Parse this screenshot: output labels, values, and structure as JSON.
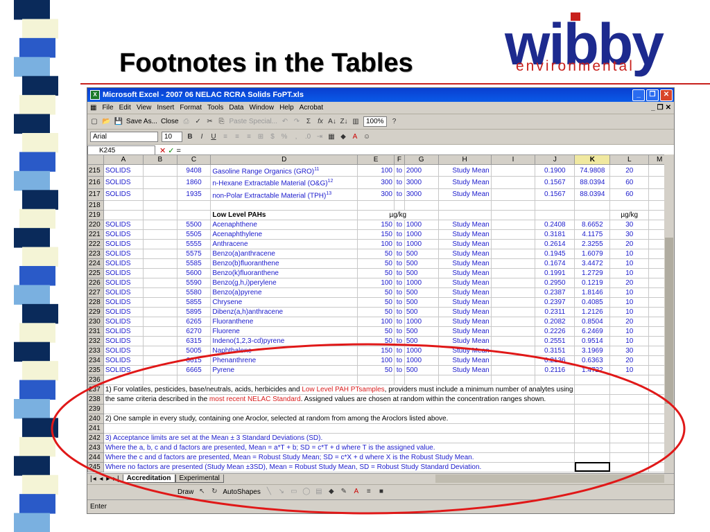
{
  "slide": {
    "title": "Footnotes in the Tables",
    "logo_word": "wibby",
    "logo_sub": "environmental",
    "stripe_colors": [
      "#0a2a5a",
      "#f4f4d6",
      "#2a5ac8",
      "#7ab0e0",
      "#0a2a5a",
      "#f4f4d6"
    ]
  },
  "excel": {
    "title": "Microsoft Excel - 2007 06 NELAC RCRA Solids FoPT.xls",
    "menu": [
      "File",
      "Edit",
      "View",
      "Insert",
      "Format",
      "Tools",
      "Data",
      "Window",
      "Help",
      "Acrobat"
    ],
    "toolbar1": {
      "save_as": "Save As...",
      "close": "Close",
      "paste_special": "Paste Special...",
      "zoom": "100%"
    },
    "toolbar2": {
      "font": "Arial",
      "size": "10"
    },
    "name_box": "K245",
    "columns": [
      "A",
      "B",
      "C",
      "D",
      "E",
      "F",
      "G",
      "H",
      "I",
      "J",
      "K",
      "L",
      "M"
    ],
    "rows": [
      {
        "n": "215",
        "a": "SOLIDS",
        "c": "9408",
        "d": "Gasoline Range Organics (GRO)",
        "sup": "11",
        "e": "100",
        "f": "to",
        "g": "2000",
        "h": "Study Mean",
        "j": "0.1900",
        "k": "74.9808",
        "l": "20"
      },
      {
        "n": "216",
        "a": "SOLIDS",
        "c": "1860",
        "d": "n-Hexane Extractable Material (O&G)",
        "sup": "12",
        "e": "300",
        "f": "to",
        "g": "3000",
        "h": "Study Mean",
        "j": "0.1567",
        "k": "88.0394",
        "l": "60"
      },
      {
        "n": "217",
        "a": "SOLIDS",
        "c": "1935",
        "d": "non-Polar Extractable Material (TPH)",
        "sup": "13",
        "e": "300",
        "f": "to",
        "g": "3000",
        "h": "Study Mean",
        "j": "0.1567",
        "k": "88.0394",
        "l": "60"
      },
      {
        "n": "218"
      },
      {
        "n": "219",
        "d": "Low Level PAHs",
        "ef": "µg/kg",
        "l": "µg/kg",
        "hdr": true
      },
      {
        "n": "220",
        "a": "SOLIDS",
        "c": "5500",
        "d": "Acenaphthene",
        "e": "150",
        "f": "to",
        "g": "1000",
        "h": "Study Mean",
        "j": "0.2408",
        "k": "8.6652",
        "l": "30"
      },
      {
        "n": "221",
        "a": "SOLIDS",
        "c": "5505",
        "d": "Acenaphthylene",
        "e": "150",
        "f": "to",
        "g": "1000",
        "h": "Study Mean",
        "j": "0.3181",
        "k": "4.1175",
        "l": "30"
      },
      {
        "n": "222",
        "a": "SOLIDS",
        "c": "5555",
        "d": "Anthracene",
        "e": "100",
        "f": "to",
        "g": "1000",
        "h": "Study Mean",
        "j": "0.2614",
        "k": "2.3255",
        "l": "20"
      },
      {
        "n": "223",
        "a": "SOLIDS",
        "c": "5575",
        "d": "Benzo(a)anthracene",
        "e": "50",
        "f": "to",
        "g": "500",
        "h": "Study Mean",
        "j": "0.1945",
        "k": "1.6079",
        "l": "10"
      },
      {
        "n": "224",
        "a": "SOLIDS",
        "c": "5585",
        "d": "Benzo(b)fluoranthene",
        "e": "50",
        "f": "to",
        "g": "500",
        "h": "Study Mean",
        "j": "0.1674",
        "k": "3.4472",
        "l": "10"
      },
      {
        "n": "225",
        "a": "SOLIDS",
        "c": "5600",
        "d": "Benzo(k)fluoranthene",
        "e": "50",
        "f": "to",
        "g": "500",
        "h": "Study Mean",
        "j": "0.1991",
        "k": "1.2729",
        "l": "10"
      },
      {
        "n": "226",
        "a": "SOLIDS",
        "c": "5590",
        "d": "Benzo(g,h,i)perylene",
        "e": "100",
        "f": "to",
        "g": "1000",
        "h": "Study Mean",
        "j": "0.2950",
        "k": "0.1219",
        "l": "20"
      },
      {
        "n": "227",
        "a": "SOLIDS",
        "c": "5580",
        "d": "Benzo(a)pyrene",
        "e": "50",
        "f": "to",
        "g": "500",
        "h": "Study Mean",
        "j": "0.2387",
        "k": "1.8146",
        "l": "10"
      },
      {
        "n": "228",
        "a": "SOLIDS",
        "c": "5855",
        "d": "Chrysene",
        "e": "50",
        "f": "to",
        "g": "500",
        "h": "Study Mean",
        "j": "0.2397",
        "k": "0.4085",
        "l": "10"
      },
      {
        "n": "229",
        "a": "SOLIDS",
        "c": "5895",
        "d": "Dibenz(a,h)anthracene",
        "e": "50",
        "f": "to",
        "g": "500",
        "h": "Study Mean",
        "j": "0.2311",
        "k": "1.2126",
        "l": "10"
      },
      {
        "n": "230",
        "a": "SOLIDS",
        "c": "6265",
        "d": "Fluoranthene",
        "e": "100",
        "f": "to",
        "g": "1000",
        "h": "Study Mean",
        "j": "0.2082",
        "k": "0.8504",
        "l": "20"
      },
      {
        "n": "231",
        "a": "SOLIDS",
        "c": "6270",
        "d": "Fluorene",
        "e": "50",
        "f": "to",
        "g": "500",
        "h": "Study Mean",
        "j": "0.2226",
        "k": "6.2469",
        "l": "10"
      },
      {
        "n": "232",
        "a": "SOLIDS",
        "c": "6315",
        "d": "Indeno(1,2,3-cd)pyrene",
        "e": "50",
        "f": "to",
        "g": "500",
        "h": "Study Mean",
        "j": "0.2551",
        "k": "0.9514",
        "l": "10"
      },
      {
        "n": "233",
        "a": "SOLIDS",
        "c": "5005",
        "d": "Naphthalene",
        "e": "150",
        "f": "to",
        "g": "1000",
        "h": "Study Mean",
        "j": "0.3151",
        "k": "3.1969",
        "l": "30"
      },
      {
        "n": "234",
        "a": "SOLIDS",
        "c": "6615",
        "d": "Phenanthrene",
        "e": "100",
        "f": "to",
        "g": "1000",
        "h": "Study Mean",
        "j": "0.2136",
        "k": "0.6363",
        "l": "20"
      },
      {
        "n": "235",
        "a": "SOLIDS",
        "c": "6665",
        "d": "Pyrene",
        "e": "50",
        "f": "to",
        "g": "500",
        "h": "Study Mean",
        "j": "0.2116",
        "k": "1.4722",
        "l": "10"
      },
      {
        "n": "236"
      }
    ],
    "notes": [
      {
        "n": "237",
        "parts": [
          {
            "t": "1) For volatiles, pesticides, base/neutrals, acids, herbicides and "
          },
          {
            "t": "Low Level PAH PTsamples",
            "red": true
          },
          {
            "t": ", providers must include a minimum number of analytes using"
          }
        ]
      },
      {
        "n": "238",
        "parts": [
          {
            "t": "the same criteria described in the "
          },
          {
            "t": "most recent NELAC Standard",
            "red": true
          },
          {
            "t": ".  Assigned values are chosen at random within the concentration ranges shown."
          }
        ]
      },
      {
        "n": "239",
        "parts": []
      },
      {
        "n": "240",
        "parts": [
          {
            "t": "2) One sample in every study, containing one Aroclor, selected at random from among the Aroclors listed above."
          }
        ]
      },
      {
        "n": "241",
        "parts": []
      },
      {
        "n": "242",
        "blue": true,
        "parts": [
          {
            "t": "3) Acceptance limits are set at the Mean ± 3 Standard Deviations (SD)."
          }
        ]
      },
      {
        "n": "243",
        "blue": true,
        "parts": [
          {
            "t": "Where the a, b, c and d factors are presented, Mean = a*T + b; SD = c*T + d where T is the assigned value."
          }
        ]
      },
      {
        "n": "244",
        "blue": true,
        "parts": [
          {
            "t": "Where the c and d factors are presented, Mean = Robust Study Mean; SD = c*X + d where X is the Robust Study Mean."
          }
        ]
      },
      {
        "n": "245",
        "blue": true,
        "parts": [
          {
            "t": "Where no factors are presented (Study Mean ±3SD), Mean = Robust Study Mean, SD = Robust Study Standard Deviation."
          }
        ]
      }
    ],
    "tabs": [
      "Accreditation",
      "Experimental"
    ],
    "draw": {
      "draw": "Draw",
      "autoshapes": "AutoShapes"
    },
    "status": "Enter"
  },
  "annotation": {
    "color": "#e01818"
  }
}
